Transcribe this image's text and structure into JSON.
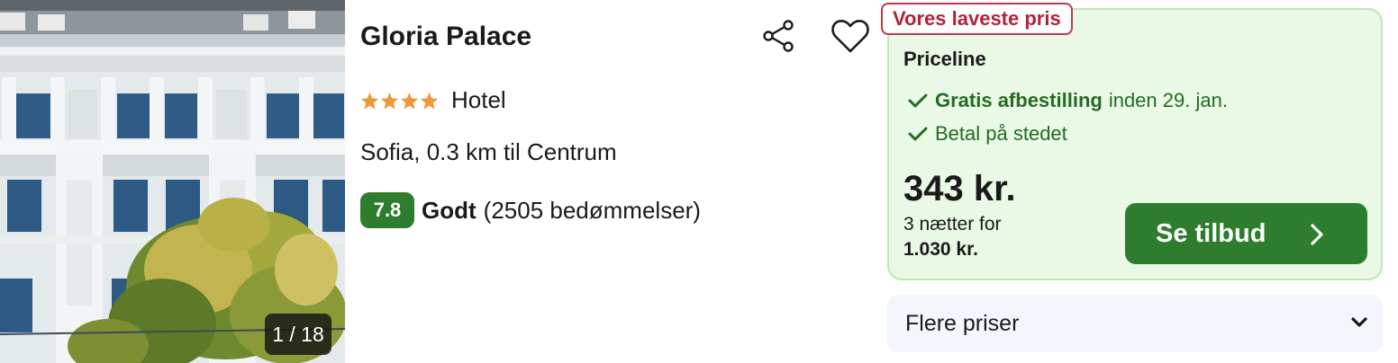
{
  "photo": {
    "counter": "1 / 18"
  },
  "hotel": {
    "name": "Gloria Palace",
    "stars": 4,
    "type": "Hotel",
    "location": "Sofia, 0.3 km til Centrum",
    "score": "7.8",
    "review_word": "Godt",
    "review_count": "(2505 bedømmelser)"
  },
  "icons": {
    "share": "share-icon",
    "favorite": "heart-icon",
    "check": "check-icon",
    "chevron_right": "chevron-right-icon",
    "chevron_down": "chevron-down-icon"
  },
  "offer": {
    "badge": "Vores laveste pris",
    "provider": "Priceline",
    "features": [
      {
        "bold": "Gratis afbestilling",
        "text": "inden 29. jan."
      },
      {
        "bold": "",
        "text": "Betal på stedet"
      }
    ],
    "price": "343 kr.",
    "nights_text": "3 nætter for",
    "total": "1.030 kr.",
    "button_label": "Se tilbud"
  },
  "more_prices": {
    "label": "Flere priser"
  },
  "colors": {
    "accent_green": "#2e7d2e",
    "badge_red": "#b3223a",
    "star_orange": "#f0973a",
    "offer_bg": "#eaf8e6"
  }
}
